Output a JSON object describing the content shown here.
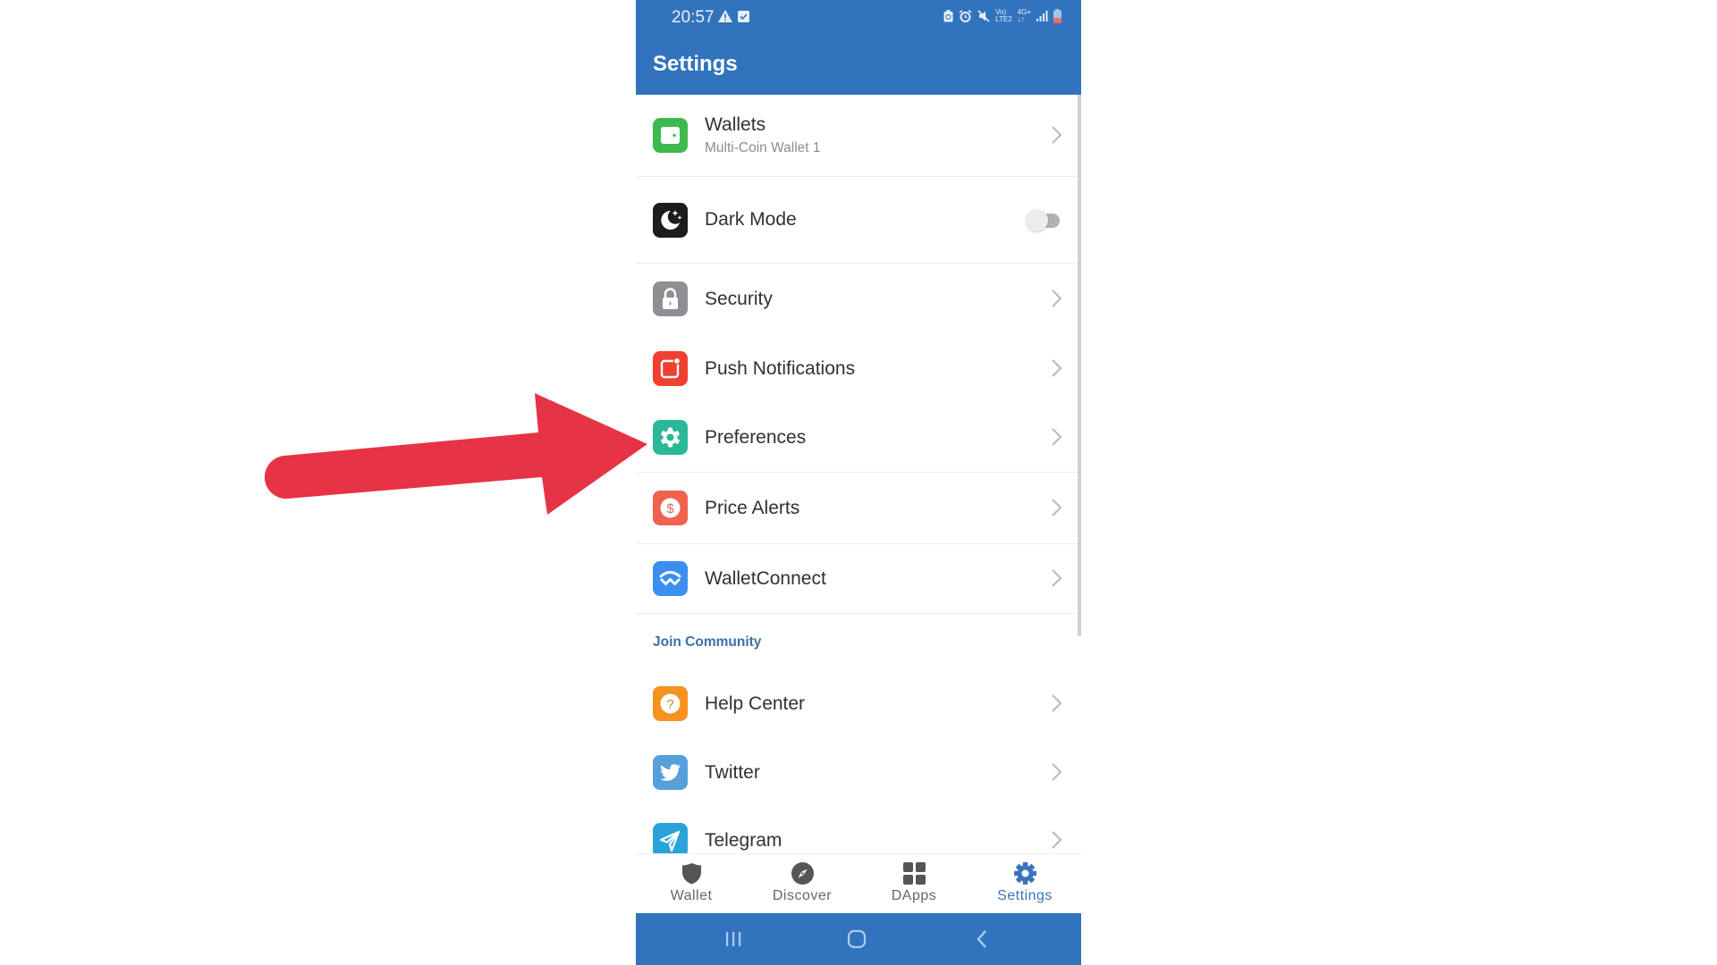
{
  "status_bar": {
    "time": "20:57",
    "left_icons": [
      "warning-icon",
      "checkbox-icon"
    ],
    "right_icons": [
      "battery-saver-icon",
      "alarm-icon",
      "mute-icon",
      "volte-lte2-icon",
      "4g-plus-icon",
      "signal-icon",
      "battery-low-icon"
    ],
    "volte_top": "Vo)",
    "volte_bottom": "LTE2",
    "net_label": "4G+"
  },
  "header": {
    "title": "Settings"
  },
  "menu": [
    {
      "label": "Wallets",
      "subtitle": "Multi-Coin Wallet 1",
      "icon": "wallet-icon",
      "color": "#3DBA4E",
      "trailing": "chevron"
    },
    {
      "label": "Dark Mode",
      "icon": "moon-stars-icon",
      "color": "#1C1C1E",
      "trailing": "toggle",
      "toggle_on": false
    },
    {
      "label": "Security",
      "icon": "lock-icon",
      "color": "#8E8E93",
      "trailing": "chevron"
    },
    {
      "label": "Push Notifications",
      "icon": "notification-badge-icon",
      "color": "#F0402F",
      "trailing": "chevron"
    },
    {
      "label": "Preferences",
      "icon": "gear-icon",
      "color": "#2BB79A",
      "trailing": "chevron"
    },
    {
      "label": "Price Alerts",
      "icon": "dollar-circle-icon",
      "color": "#F0624F",
      "trailing": "chevron"
    },
    {
      "label": "WalletConnect",
      "icon": "walletconnect-icon",
      "color": "#3B8FEF",
      "trailing": "chevron"
    }
  ],
  "community": {
    "section_title": "Join Community",
    "items": [
      {
        "label": "Help Center",
        "icon": "question-circle-icon",
        "color": "#F6921E",
        "trailing": "chevron"
      },
      {
        "label": "Twitter",
        "icon": "twitter-bird-icon",
        "color": "#55A0DB",
        "trailing": "chevron"
      },
      {
        "label": "Telegram",
        "icon": "telegram-plane-icon",
        "color": "#2AA3DB",
        "trailing": "chevron"
      }
    ]
  },
  "tabs": [
    {
      "label": "Wallet",
      "icon": "shield-icon",
      "active": false
    },
    {
      "label": "Discover",
      "icon": "compass-icon",
      "active": false
    },
    {
      "label": "DApps",
      "icon": "grid-icon",
      "active": false
    },
    {
      "label": "Settings",
      "icon": "gear-icon",
      "active": true
    }
  ],
  "system_nav": [
    "recents-icon",
    "home-icon",
    "back-icon"
  ],
  "annotation": {
    "type": "arrow",
    "points_to": "Preferences",
    "color": "#E63345"
  },
  "colors": {
    "primary": "#3273BD",
    "tab_active": "#3A74B8",
    "tab_inactive": "#666666",
    "section_title": "#3D6FA7"
  }
}
